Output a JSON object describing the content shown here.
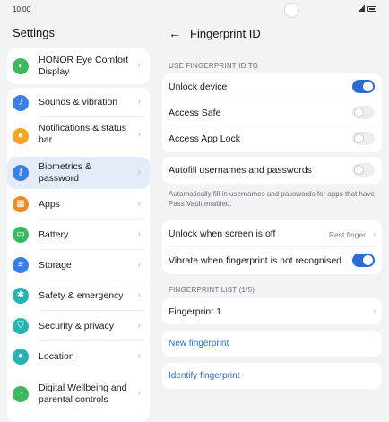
{
  "status": {
    "time": "10:00"
  },
  "settings": {
    "title": "Settings",
    "items": [
      {
        "label": "HONOR Eye Comfort Display",
        "icon": "eye-comfort-icon",
        "color": "#3cb95c"
      },
      {
        "label": "Sounds & vibration",
        "icon": "sound-icon",
        "color": "#3a7ee8"
      },
      {
        "label": "Notifications & status bar",
        "icon": "bell-icon",
        "color": "#f5a524"
      },
      {
        "label": "Biometrics & password",
        "icon": "key-icon",
        "color": "#3a7ee8"
      },
      {
        "label": "Apps",
        "icon": "apps-grid-icon",
        "color": "#f08a24"
      },
      {
        "label": "Battery",
        "icon": "battery-icon",
        "color": "#3cb95c"
      },
      {
        "label": "Storage",
        "icon": "storage-icon",
        "color": "#3a7ee8"
      },
      {
        "label": "Safety & emergency",
        "icon": "asterisk-icon",
        "color": "#24b4b4"
      },
      {
        "label": "Security & privacy",
        "icon": "shield-icon",
        "color": "#24b4b4"
      },
      {
        "label": "Location",
        "icon": "location-pin-icon",
        "color": "#24b4b4"
      },
      {
        "label": "Digital Wellbeing and parental controls",
        "icon": "wellbeing-icon",
        "color": "#3cb95c"
      }
    ]
  },
  "fingerprint": {
    "back_icon": "arrow-left-icon",
    "title": "Fingerprint ID",
    "use_section_label": "USE FINGERPRINT ID TO",
    "unlock_device": {
      "label": "Unlock device",
      "on": true
    },
    "access_safe": {
      "label": "Access Safe",
      "on": false
    },
    "access_app_lock": {
      "label": "Access App Lock",
      "on": false
    },
    "autofill": {
      "label": "Autofill usernames and passwords",
      "on": false
    },
    "autofill_note": "Automatically fill in usernames and passwords for apps that have Pass Vault enabled.",
    "unlock_screen_off": {
      "label": "Unlock when screen is off",
      "value": "Rest finger"
    },
    "vibrate": {
      "label": "Vibrate when fingerprint is not recognised",
      "on": true
    },
    "list_section_label": "FINGERPRINT LIST (1/5)",
    "fingerprint_1": "Fingerprint 1",
    "new_fingerprint": "New fingerprint",
    "identify_fingerprint": "Identify fingerprint"
  },
  "colors": {
    "accent": "#2a6bd4",
    "selected_bg": "#e3ecf8"
  }
}
